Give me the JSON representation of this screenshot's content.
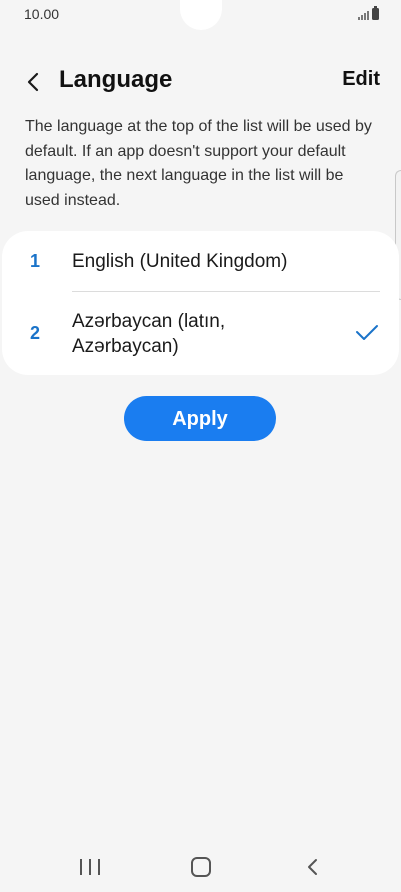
{
  "status_bar": {
    "time": "10.00"
  },
  "header": {
    "title": "Language",
    "edit_label": "Edit"
  },
  "description": "The language at the top of the list will be used by default. If an app doesn't support your default language, the next language in the list will be used instead.",
  "languages": [
    {
      "number": "1",
      "label": "English (United Kingdom)",
      "selected": false
    },
    {
      "number": "2",
      "label": "Azərbaycan (latın, Azərbaycan)",
      "selected": true
    }
  ],
  "apply_label": "Apply",
  "icons": {
    "back": "back-arrow-icon",
    "check": "check-icon",
    "signal": "signal-icon",
    "battery": "battery-icon",
    "nav_recents": "recents-icon",
    "nav_home": "home-icon",
    "nav_back": "back-icon"
  },
  "colors": {
    "accent": "#1a7df0",
    "number": "#1a73c9",
    "background": "#f5f5f5",
    "card": "#ffffff"
  }
}
